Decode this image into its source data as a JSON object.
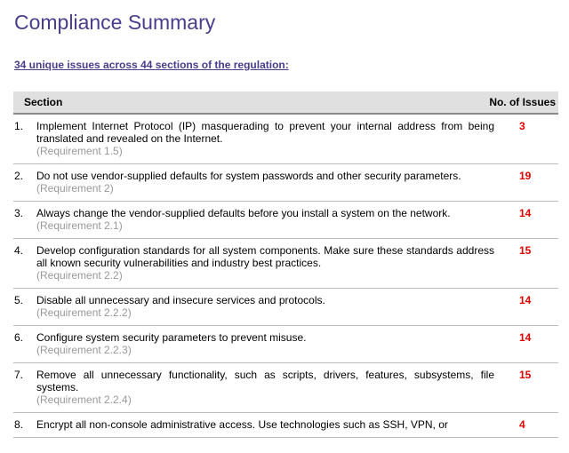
{
  "page": {
    "title": "Compliance Summary",
    "summary_link": "34 unique issues across 44 sections of the regulation:"
  },
  "table": {
    "headers": {
      "section": "Section",
      "issues": "No. of Issues"
    },
    "rows": [
      {
        "num": "1.",
        "text": "Implement Internet Protocol (IP) masquerading to prevent your internal address from being translated and revealed on the Internet.",
        "requirement": "(Requirement 1.5)",
        "count": "3"
      },
      {
        "num": "2.",
        "text": "Do not use vendor-supplied defaults for system passwords and other security parameters.",
        "requirement": "(Requirement 2)",
        "count": "19"
      },
      {
        "num": "3.",
        "text": "Always change the vendor-supplied defaults before you install a system on the network.",
        "requirement": "(Requirement 2.1)",
        "count": "14"
      },
      {
        "num": "4.",
        "text": "Develop configuration standards for all system components. Make sure these standards address all known security vulnerabilities and industry best practices.",
        "requirement": "(Requirement 2.2)",
        "count": "15"
      },
      {
        "num": "5.",
        "text": "Disable all unnecessary and insecure services and protocols.",
        "requirement": "(Requirement 2.2.2)",
        "count": "14"
      },
      {
        "num": "6.",
        "text": "Configure system security parameters to prevent misuse.",
        "requirement": "(Requirement 2.2.3)",
        "count": "14"
      },
      {
        "num": "7.",
        "text": "Remove all unnecessary functionality, such as scripts, drivers, features, subsystems, file systems.",
        "requirement": "(Requirement 2.2.4)",
        "count": "15"
      },
      {
        "num": "8.",
        "text": "Encrypt all non-console administrative access. Use technologies such as SSH, VPN, or",
        "requirement": "",
        "count": "4"
      }
    ]
  },
  "colors": {
    "title": "#4b3c8c",
    "count": "#e00000",
    "requirement": "#999999",
    "header_bg": "#e0e0e0"
  }
}
